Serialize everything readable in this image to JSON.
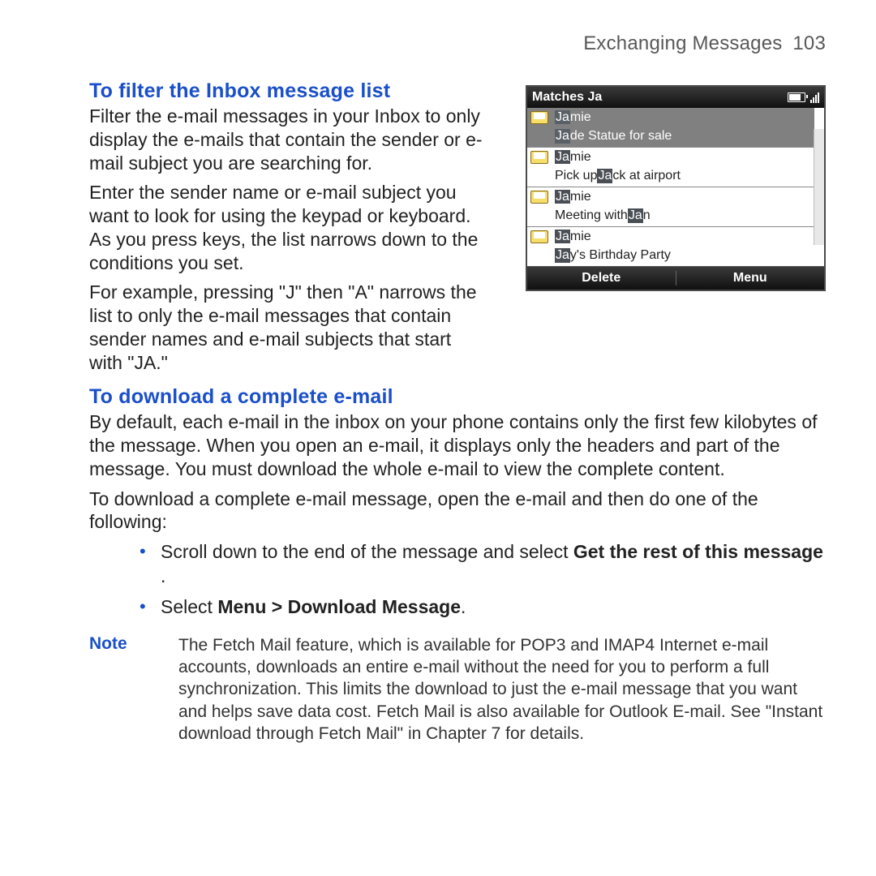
{
  "running_head": {
    "title": "Exchanging Messages",
    "page_number": "103"
  },
  "section1": {
    "heading": "To filter the Inbox message list",
    "p1": "Filter the e-mail messages in your Inbox to only display the e-mails that contain the sender or e-mail subject you are searching for.",
    "p2": "Enter the sender name or e-mail subject you want to look for using the keypad or keyboard. As you press keys, the list narrows down to the conditions you set.",
    "p3": "For example, pressing \"J\" then \"A\" narrows the list to only the e-mail messages that contain sender names and e-mail subjects that start with \"JA.\""
  },
  "section2": {
    "heading": "To download a complete e-mail",
    "p1": "By default, each e-mail in the inbox on your phone contains only the first few kilobytes of the message. When you open an e-mail, it displays only the headers and part of the message. You must download the whole e-mail to view the complete content.",
    "p2": "To download a complete e-mail message, open the e-mail and then do one of the following:",
    "bullet1_pre": "Scroll down to the end of the message and select ",
    "bullet1_bold": "Get the rest of this message",
    "bullet1_post": " .",
    "bullet2_pre": "Select ",
    "bullet2_bold": "Menu > Download Message",
    "bullet2_post": "."
  },
  "note": {
    "label": "Note",
    "body": "The Fetch Mail feature, which is available for POP3 and IMAP4 Internet e-mail accounts, downloads an entire e-mail without the need for you to perform a full synchronization. This limits the download to just the e-mail message that you want and helps save data cost. Fetch Mail is also available for Outlook E-mail. See \"Instant download through Fetch Mail\" in Chapter 7 for details."
  },
  "screenshot": {
    "title": "Matches Ja",
    "rows": [
      {
        "selected": true,
        "sender_hl": "Ja",
        "sender_rest": "mie",
        "subject_hl": "Ja",
        "subject_rest": "de Statue for sale"
      },
      {
        "selected": false,
        "sender_hl": "Ja",
        "sender_rest": "mie",
        "subject_pre": "Pick up ",
        "subject_hl": "Ja",
        "subject_rest": "ck at airport"
      },
      {
        "selected": false,
        "sender_hl": "Ja",
        "sender_rest": "mie",
        "subject_pre": "Meeting with ",
        "subject_hl": "Ja",
        "subject_rest": "n"
      },
      {
        "selected": false,
        "sender_hl": "Ja",
        "sender_rest": "mie",
        "subject_hl": "Ja",
        "subject_rest": "y's Birthday Party"
      }
    ],
    "softkeys": {
      "left": "Delete",
      "right": "Menu"
    }
  }
}
